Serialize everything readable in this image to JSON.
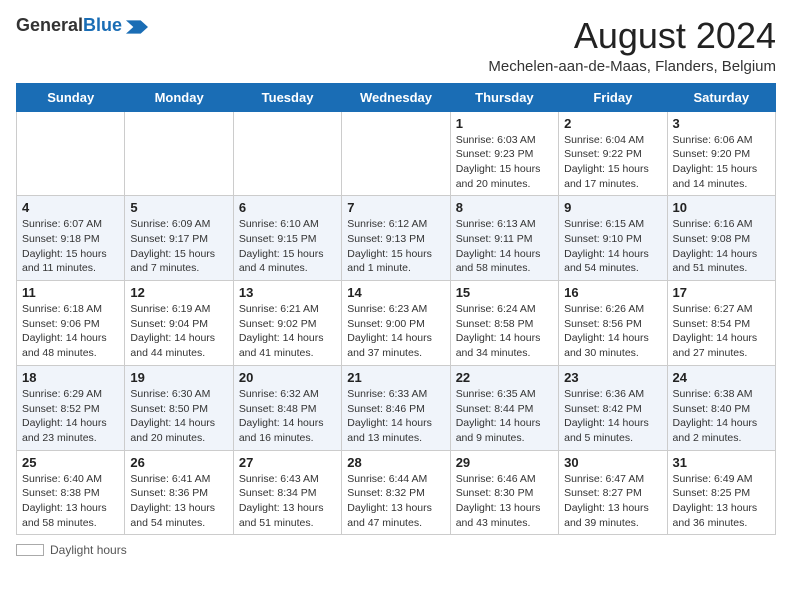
{
  "logo": {
    "line1": "General",
    "line2": "Blue",
    "aria": "GeneralBlue logo"
  },
  "title": {
    "month_year": "August 2024",
    "location": "Mechelen-aan-de-Maas, Flanders, Belgium"
  },
  "days_of_week": [
    "Sunday",
    "Monday",
    "Tuesday",
    "Wednesday",
    "Thursday",
    "Friday",
    "Saturday"
  ],
  "weeks": [
    [
      {
        "day": "",
        "info": ""
      },
      {
        "day": "",
        "info": ""
      },
      {
        "day": "",
        "info": ""
      },
      {
        "day": "",
        "info": ""
      },
      {
        "day": "1",
        "info": "Sunrise: 6:03 AM\nSunset: 9:23 PM\nDaylight: 15 hours and 20 minutes."
      },
      {
        "day": "2",
        "info": "Sunrise: 6:04 AM\nSunset: 9:22 PM\nDaylight: 15 hours and 17 minutes."
      },
      {
        "day": "3",
        "info": "Sunrise: 6:06 AM\nSunset: 9:20 PM\nDaylight: 15 hours and 14 minutes."
      }
    ],
    [
      {
        "day": "4",
        "info": "Sunrise: 6:07 AM\nSunset: 9:18 PM\nDaylight: 15 hours and 11 minutes."
      },
      {
        "day": "5",
        "info": "Sunrise: 6:09 AM\nSunset: 9:17 PM\nDaylight: 15 hours and 7 minutes."
      },
      {
        "day": "6",
        "info": "Sunrise: 6:10 AM\nSunset: 9:15 PM\nDaylight: 15 hours and 4 minutes."
      },
      {
        "day": "7",
        "info": "Sunrise: 6:12 AM\nSunset: 9:13 PM\nDaylight: 15 hours and 1 minute."
      },
      {
        "day": "8",
        "info": "Sunrise: 6:13 AM\nSunset: 9:11 PM\nDaylight: 14 hours and 58 minutes."
      },
      {
        "day": "9",
        "info": "Sunrise: 6:15 AM\nSunset: 9:10 PM\nDaylight: 14 hours and 54 minutes."
      },
      {
        "day": "10",
        "info": "Sunrise: 6:16 AM\nSunset: 9:08 PM\nDaylight: 14 hours and 51 minutes."
      }
    ],
    [
      {
        "day": "11",
        "info": "Sunrise: 6:18 AM\nSunset: 9:06 PM\nDaylight: 14 hours and 48 minutes."
      },
      {
        "day": "12",
        "info": "Sunrise: 6:19 AM\nSunset: 9:04 PM\nDaylight: 14 hours and 44 minutes."
      },
      {
        "day": "13",
        "info": "Sunrise: 6:21 AM\nSunset: 9:02 PM\nDaylight: 14 hours and 41 minutes."
      },
      {
        "day": "14",
        "info": "Sunrise: 6:23 AM\nSunset: 9:00 PM\nDaylight: 14 hours and 37 minutes."
      },
      {
        "day": "15",
        "info": "Sunrise: 6:24 AM\nSunset: 8:58 PM\nDaylight: 14 hours and 34 minutes."
      },
      {
        "day": "16",
        "info": "Sunrise: 6:26 AM\nSunset: 8:56 PM\nDaylight: 14 hours and 30 minutes."
      },
      {
        "day": "17",
        "info": "Sunrise: 6:27 AM\nSunset: 8:54 PM\nDaylight: 14 hours and 27 minutes."
      }
    ],
    [
      {
        "day": "18",
        "info": "Sunrise: 6:29 AM\nSunset: 8:52 PM\nDaylight: 14 hours and 23 minutes."
      },
      {
        "day": "19",
        "info": "Sunrise: 6:30 AM\nSunset: 8:50 PM\nDaylight: 14 hours and 20 minutes."
      },
      {
        "day": "20",
        "info": "Sunrise: 6:32 AM\nSunset: 8:48 PM\nDaylight: 14 hours and 16 minutes."
      },
      {
        "day": "21",
        "info": "Sunrise: 6:33 AM\nSunset: 8:46 PM\nDaylight: 14 hours and 13 minutes."
      },
      {
        "day": "22",
        "info": "Sunrise: 6:35 AM\nSunset: 8:44 PM\nDaylight: 14 hours and 9 minutes."
      },
      {
        "day": "23",
        "info": "Sunrise: 6:36 AM\nSunset: 8:42 PM\nDaylight: 14 hours and 5 minutes."
      },
      {
        "day": "24",
        "info": "Sunrise: 6:38 AM\nSunset: 8:40 PM\nDaylight: 14 hours and 2 minutes."
      }
    ],
    [
      {
        "day": "25",
        "info": "Sunrise: 6:40 AM\nSunset: 8:38 PM\nDaylight: 13 hours and 58 minutes."
      },
      {
        "day": "26",
        "info": "Sunrise: 6:41 AM\nSunset: 8:36 PM\nDaylight: 13 hours and 54 minutes."
      },
      {
        "day": "27",
        "info": "Sunrise: 6:43 AM\nSunset: 8:34 PM\nDaylight: 13 hours and 51 minutes."
      },
      {
        "day": "28",
        "info": "Sunrise: 6:44 AM\nSunset: 8:32 PM\nDaylight: 13 hours and 47 minutes."
      },
      {
        "day": "29",
        "info": "Sunrise: 6:46 AM\nSunset: 8:30 PM\nDaylight: 13 hours and 43 minutes."
      },
      {
        "day": "30",
        "info": "Sunrise: 6:47 AM\nSunset: 8:27 PM\nDaylight: 13 hours and 39 minutes."
      },
      {
        "day": "31",
        "info": "Sunrise: 6:49 AM\nSunset: 8:25 PM\nDaylight: 13 hours and 36 minutes."
      }
    ]
  ],
  "footer": {
    "label": "Daylight hours"
  }
}
